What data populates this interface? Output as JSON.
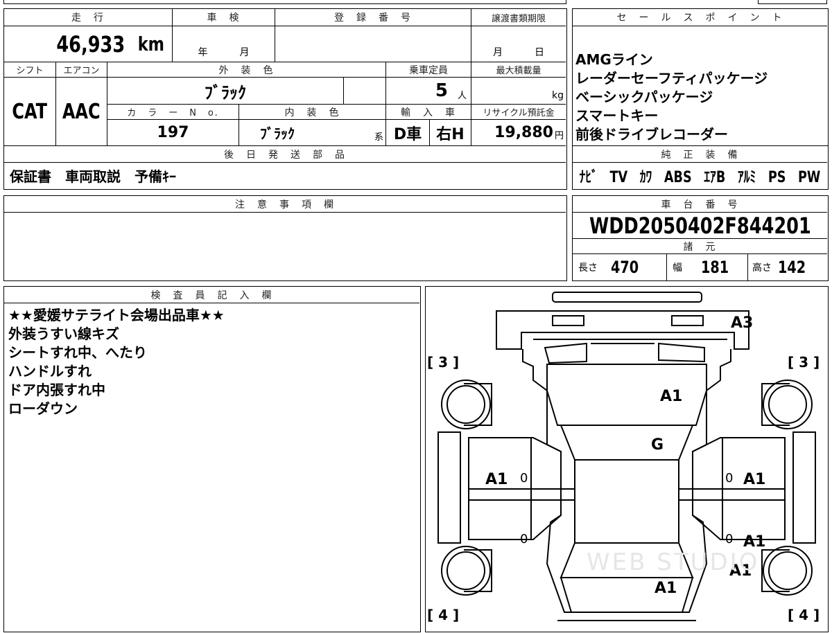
{
  "header": {
    "mileage_label": "走　行",
    "inspection_label": "車　検",
    "reg_label": "登　録　番　号",
    "transfer_label": "譲渡書類期限",
    "sales_label": "セ　ー　ル　ス　ポ　イ　ン　ト"
  },
  "mileage": {
    "value": "46,933",
    "unit": "km"
  },
  "inspection": {
    "year_label": "年",
    "month_label": "月"
  },
  "transfer": {
    "month_label": "月",
    "day_label": "日"
  },
  "row2": {
    "shift_label": "シフト",
    "ac_label": "エアコン",
    "ext_color_label": "外　装　色",
    "capacity_label": "乗車定員",
    "max_load_label": "最大積載量",
    "shift_value": "CAT",
    "ac_value": "AAC",
    "ext_color_value": "ﾌﾞﾗｯｸ",
    "capacity_value": "5",
    "capacity_unit": "人",
    "load_unit": "kg"
  },
  "row3": {
    "color_no_label": "カ　ラ　ー　N　o.",
    "int_color_label": "内　装　色",
    "import_label": "輸　入　車",
    "recycle_label": "リサイクル預託金",
    "color_no_value": "197",
    "int_color_value": "ﾌﾞﾗｯｸ",
    "int_suffix": "系",
    "import_value": "D車",
    "handle_value": "右H",
    "recycle_value": "19,880",
    "recycle_unit": "円"
  },
  "sales_points": [
    "AMGライン",
    "レーダーセーフティパッケージ",
    "ベーシックパッケージ",
    "スマートキー",
    "前後ドライブレコーダー"
  ],
  "later_parts": {
    "label": "後　日　発　送　部　品",
    "value": "保証書　車両取説　予備ｷｰ"
  },
  "equipment": {
    "label": "純　正　装　備",
    "value": "ﾅﾋﾞ　TV　ｶﾜ　ABS　ｴｱB　ｱﾙﾐ　PS　PW"
  },
  "notes": {
    "label": "注　意　事　項　欄"
  },
  "chassis": {
    "label": "車　台　番　号",
    "value": "WDD2050402F844201"
  },
  "specs": {
    "label": "諸　元",
    "length_label": "長さ",
    "length_value": "470",
    "width_label": "幅",
    "width_value": "181",
    "height_label": "高さ",
    "height_value": "142"
  },
  "inspector": {
    "label": "検　査　員　記　入　欄",
    "lines": [
      "★★愛媛サテライト会場出品車★★",
      "外装うすい線キズ",
      "シートすれ中、へたり",
      "ハンドルすれ",
      "ドア内張すれ中",
      "ローダウン"
    ]
  },
  "diagram": {
    "marks": [
      "A3",
      "A1",
      "G",
      "A1",
      "A1",
      "A1",
      "A1",
      "A1",
      "A1"
    ],
    "zeros": [
      "0",
      "0",
      "0",
      "0"
    ],
    "tire_front_left": "[ 3 ]",
    "tire_front_right": "[ 3 ]",
    "tire_rear_left": "[ 4 ]",
    "tire_rear_right": "[ 4 ]",
    "watermark": "WEB STUDIO"
  }
}
